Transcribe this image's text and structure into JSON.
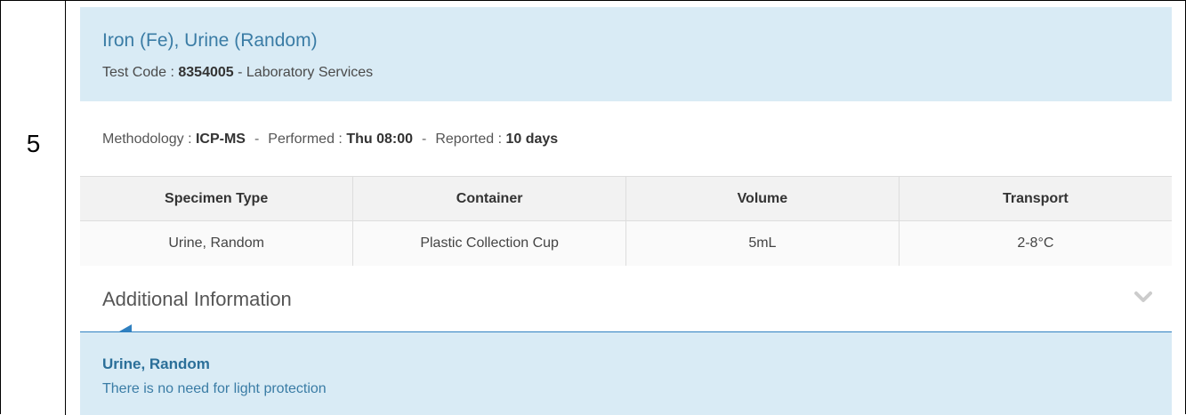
{
  "row": {
    "number": "5"
  },
  "test": {
    "name": "Iron (Fe), Urine (Random)",
    "code_label": "Test Code : ",
    "code": "8354005",
    "code_suffix": " - Laboratory Services"
  },
  "meta": {
    "methodology_label": "Methodology : ",
    "methodology": "ICP-MS",
    "sep1": "-",
    "performed_label": "Performed : ",
    "performed": "Thu 08:00",
    "sep2": "-",
    "reported_label": "Reported : ",
    "reported": "10 days"
  },
  "specimen_table": {
    "headers": [
      "Specimen Type",
      "Container",
      "Volume",
      "Transport"
    ],
    "rows": [
      [
        "Urine, Random",
        "Plastic Collection Cup",
        "5mL",
        "2-8°C"
      ]
    ]
  },
  "additional_info": {
    "title": "Additional Information",
    "expand_icon": "chevron-down-icon",
    "body_title": "Urine, Random",
    "body_text": "There is no need for light protection"
  },
  "colors": {
    "header_bg": "#d9ebf5",
    "link_blue": "#3a7ca5",
    "accent_line": "#2f80c0"
  }
}
